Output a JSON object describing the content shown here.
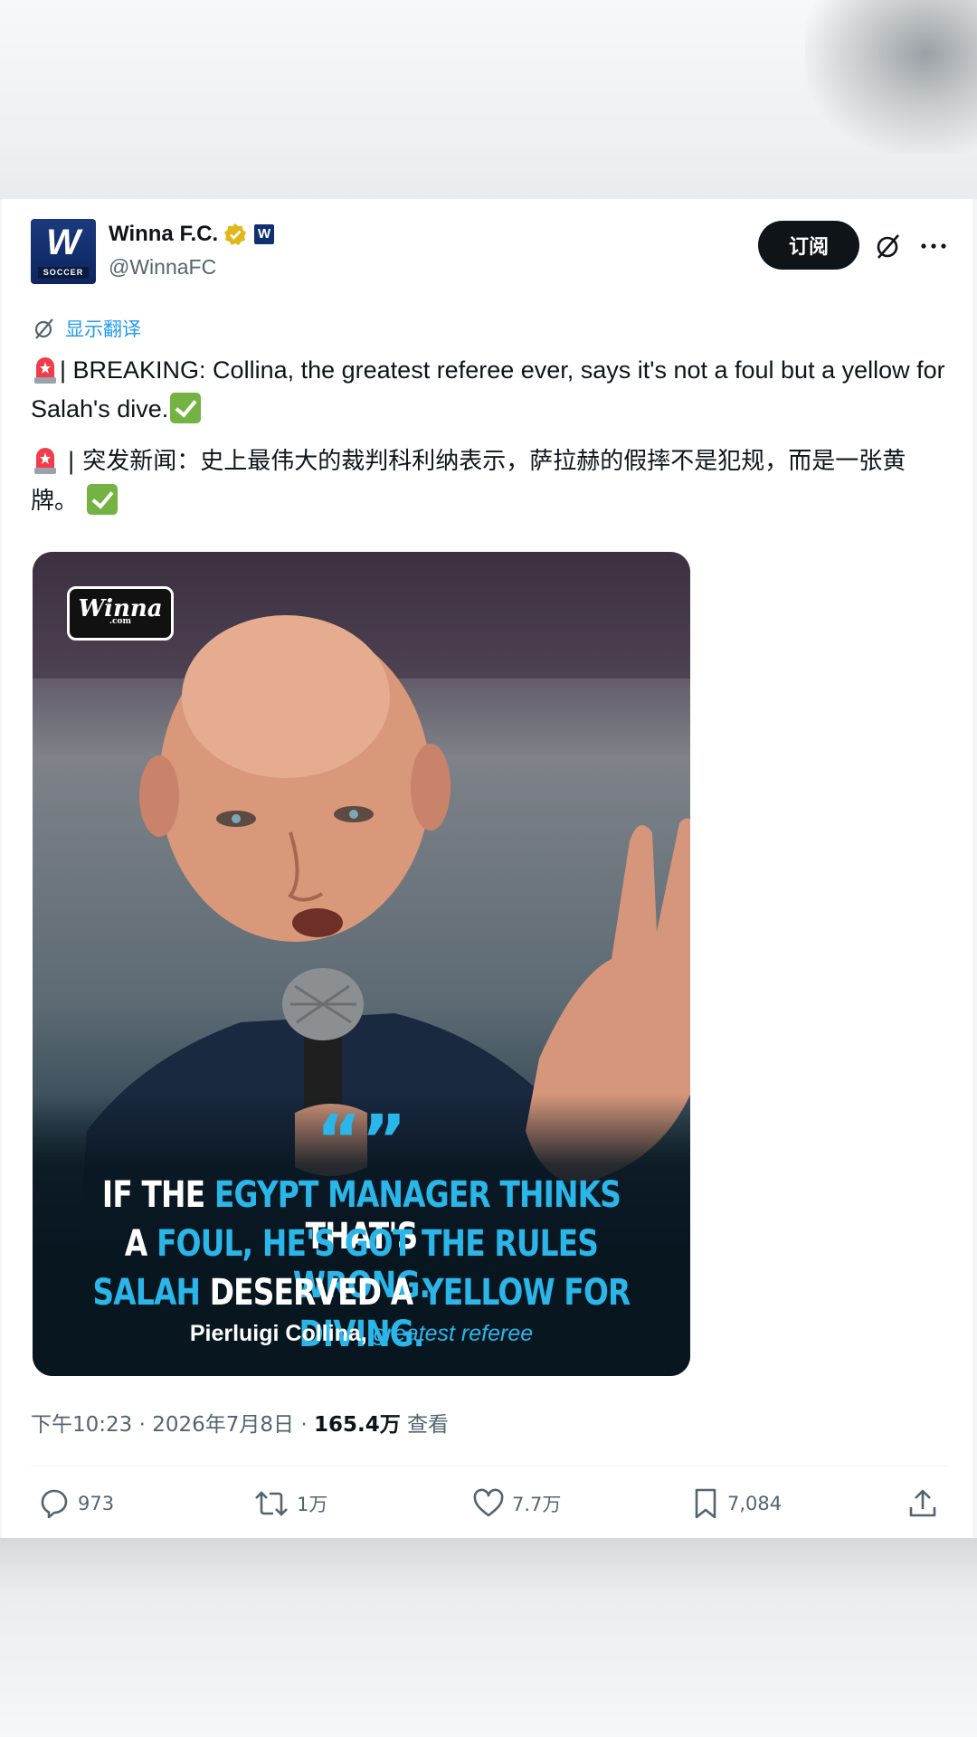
{
  "author": {
    "name": "Winna F.C.",
    "handle": "@WinnaFC",
    "avatar_letter": "W",
    "avatar_sub": "SOCCER",
    "badge_letter": "W"
  },
  "header": {
    "subscribe_label": "订阅"
  },
  "translate_label": "显示翻译",
  "tweet": {
    "text_en": "| BREAKING: Collina, the greatest referee ever, says it's not a foul but a yellow for Salah's dive.",
    "text_cn": " | 突发新闻：史上最伟大的裁判科利纳表示，萨拉赫的假摔不是犯规，而是一张黄牌。 "
  },
  "media": {
    "logo_text": "Winna",
    "logo_sub": ".com",
    "quote_marks": "“”",
    "line1": [
      [
        "IF THE ",
        false
      ],
      [
        "EGYPT MANAGER THINKS",
        true
      ],
      [
        " THAT'S",
        false
      ]
    ],
    "line2": [
      [
        "A ",
        false
      ],
      [
        "FOUL, HE'S GOT THE RULES WRONG.",
        true
      ]
    ],
    "line3": [
      [
        "SALAH",
        true
      ],
      [
        " DESERVED A ",
        false
      ],
      [
        "YELLOW FOR DIVING.",
        true
      ]
    ],
    "attribution_name": "Pierluigi Collina,",
    "attribution_role": "greatest referee"
  },
  "meta": {
    "time_date": "下午10:23 · 2026年7月8日 · ",
    "views": "165.4万",
    "views_label": " 查看"
  },
  "actions": {
    "replies": "973",
    "reposts": "1万",
    "likes": "7.7万",
    "bookmarks": "7,084"
  },
  "colors": {
    "accent": "#1d9bf0",
    "quote_highlight": "#2ab6e8",
    "text_secondary": "#536471",
    "verified_gold": "#e2b719"
  }
}
